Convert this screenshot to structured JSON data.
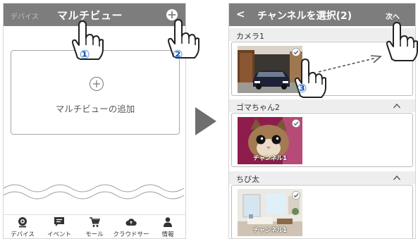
{
  "left_screen": {
    "tab_devices": "デバイス",
    "tab_multiview": "マルチビュー",
    "add_label": "マルチビューの追加",
    "nav": [
      {
        "label": "デバイス",
        "icon": "camera-icon"
      },
      {
        "label": "イベント",
        "icon": "message-icon"
      },
      {
        "label": "モール",
        "icon": "cart-icon"
      },
      {
        "label": "クラウドサー",
        "icon": "cloud-icon"
      },
      {
        "label": "情報",
        "icon": "person-icon"
      }
    ]
  },
  "right_screen": {
    "back": "<",
    "title": "チャンネルを選択(2)",
    "next": "次へ",
    "groups": [
      {
        "name": "カメラ1",
        "channel_label": ""
      },
      {
        "name": "ゴマちゃん2",
        "channel_label": "チャンネル1"
      },
      {
        "name": "ちび太",
        "channel_label": "チャンネル1"
      }
    ]
  },
  "steps": [
    "①",
    "②",
    "③"
  ],
  "colors": {
    "header": "#7d7d7d",
    "accent_step": "#1c5fb8",
    "border": "#bcbcbc"
  }
}
